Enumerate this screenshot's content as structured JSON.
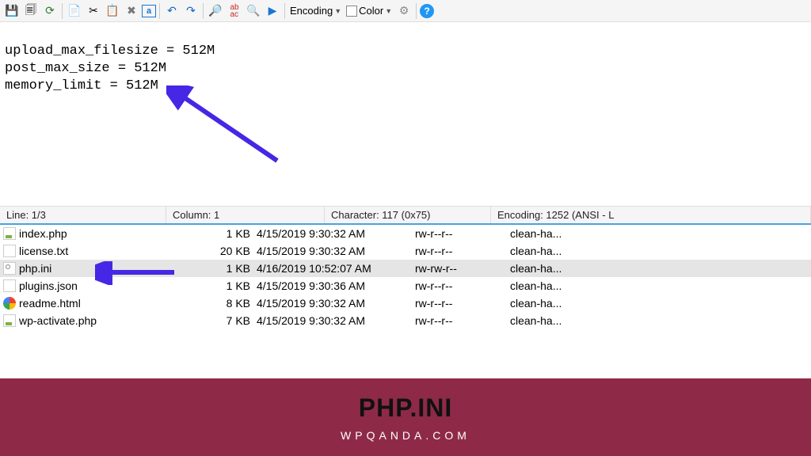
{
  "toolbar": {
    "encoding_label": "Encoding",
    "color_label": "Color"
  },
  "editor": {
    "line1": "upload_max_filesize = 512M",
    "line2": "post_max_size = 512M",
    "line3": "memory_limit = 512M"
  },
  "status": {
    "line": "Line: 1/3",
    "column": "Column: 1",
    "character": "Character: 117 (0x75)",
    "encoding": "Encoding: 1252  (ANSI - L"
  },
  "files": [
    {
      "name": "index.php",
      "size": "1 KB",
      "date": "4/15/2019 9:30:32 AM",
      "perm": "rw-r--r--",
      "owner": "clean-ha...",
      "icon": "php",
      "selected": false
    },
    {
      "name": "license.txt",
      "size": "20 KB",
      "date": "4/15/2019 9:30:32 AM",
      "perm": "rw-r--r--",
      "owner": "clean-ha...",
      "icon": "txt",
      "selected": false
    },
    {
      "name": "php.ini",
      "size": "1 KB",
      "date": "4/16/2019 10:52:07 AM",
      "perm": "rw-rw-r--",
      "owner": "clean-ha...",
      "icon": "ini",
      "selected": true
    },
    {
      "name": "plugins.json",
      "size": "1 KB",
      "date": "4/15/2019 9:30:36 AM",
      "perm": "rw-r--r--",
      "owner": "clean-ha...",
      "icon": "json",
      "selected": false
    },
    {
      "name": "readme.html",
      "size": "8 KB",
      "date": "4/15/2019 9:30:32 AM",
      "perm": "rw-r--r--",
      "owner": "clean-ha...",
      "icon": "html",
      "selected": false
    },
    {
      "name": "wp-activate.php",
      "size": "7 KB",
      "date": "4/15/2019 9:30:32 AM",
      "perm": "rw-r--r--",
      "owner": "clean-ha...",
      "icon": "php",
      "selected": false
    }
  ],
  "footer": {
    "title": "PHP.INI",
    "subtitle": "WPQANDA.COM"
  }
}
